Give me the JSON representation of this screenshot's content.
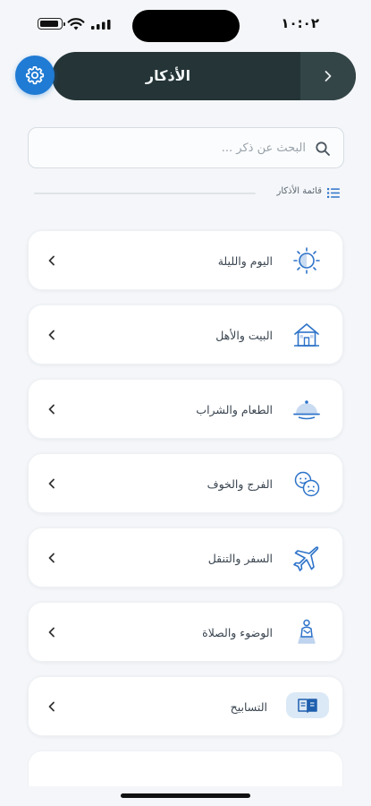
{
  "status_bar": {
    "time": "١٠:٠٢"
  },
  "header": {
    "title": "الأذكار"
  },
  "search": {
    "placeholder": "البحث عن ذكر ..."
  },
  "section": {
    "label": "قائمة الأذكار"
  },
  "items": [
    {
      "label": "اليوم والليلة",
      "icon": "day-night-icon"
    },
    {
      "label": "البيت والأهل",
      "icon": "house-icon"
    },
    {
      "label": "الطعام والشراب",
      "icon": "food-tray-icon"
    },
    {
      "label": "الفرج والخوف",
      "icon": "emotions-icon"
    },
    {
      "label": "السفر والتنقل",
      "icon": "airplane-icon"
    },
    {
      "label": "الوضوء والصلاة",
      "icon": "praying-person-icon"
    },
    {
      "label": "التسابيح",
      "icon": "book-icon"
    }
  ],
  "colors": {
    "accent": "#1f7bd4",
    "header_bg": "#243437",
    "icon_blue": "#2d73c9"
  }
}
